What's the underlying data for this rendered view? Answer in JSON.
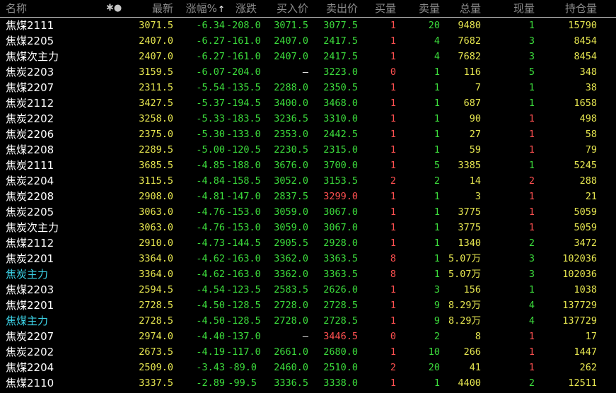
{
  "columns": {
    "name": "名称",
    "last": "最新",
    "pct": "涨幅%",
    "chg": "涨跌",
    "bid": "买入价",
    "ask": "卖出价",
    "bid_vol": "买量",
    "ask_vol": "卖量",
    "volume": "总量",
    "cur_vol": "现量",
    "open_interest": "持仓量"
  },
  "header_icons": {
    "star": "✱",
    "dot": "●",
    "sort_arrow": "↑"
  },
  "colors": {
    "background": "#000000",
    "up": "#ff5050",
    "down": "#3cdc3c",
    "price_yellow": "#e6e650",
    "highlight_name": "#3cd2e6",
    "header_text": "#8c8c8c"
  },
  "rows": [
    {
      "name": "焦煤2111",
      "last": "3071.5",
      "pct": "-6.34",
      "chg": "-208.0",
      "bid": "3071.5",
      "ask": "3077.5",
      "bid_vol": "1",
      "ask_vol": "20",
      "volume": "9480",
      "cur_vol": "1",
      "open_interest": "15790",
      "name_color": "normal",
      "bid_color": "green",
      "ask_color": "green",
      "cur_color": "green",
      "selected": true
    },
    {
      "name": "焦煤2205",
      "last": "2407.0",
      "pct": "-6.27",
      "chg": "-161.0",
      "bid": "2407.0",
      "ask": "2417.5",
      "bid_vol": "1",
      "ask_vol": "4",
      "volume": "7682",
      "cur_vol": "3",
      "open_interest": "8454",
      "name_color": "normal",
      "bid_color": "green",
      "ask_color": "green",
      "cur_color": "green"
    },
    {
      "name": "焦煤次主力",
      "last": "2407.0",
      "pct": "-6.27",
      "chg": "-161.0",
      "bid": "2407.0",
      "ask": "2417.5",
      "bid_vol": "1",
      "ask_vol": "4",
      "volume": "7682",
      "cur_vol": "3",
      "open_interest": "8454",
      "name_color": "normal",
      "bid_color": "green",
      "ask_color": "green",
      "cur_color": "green"
    },
    {
      "name": "焦炭2203",
      "last": "3159.5",
      "pct": "-6.07",
      "chg": "-204.0",
      "bid": "—",
      "ask": "3223.0",
      "bid_vol": "0",
      "ask_vol": "1",
      "volume": "116",
      "cur_vol": "5",
      "open_interest": "348",
      "name_color": "normal",
      "bid_color": "dash",
      "ask_color": "green",
      "cur_color": "green"
    },
    {
      "name": "焦煤2207",
      "last": "2311.5",
      "pct": "-5.54",
      "chg": "-135.5",
      "bid": "2288.0",
      "ask": "2350.5",
      "bid_vol": "1",
      "ask_vol": "1",
      "volume": "7",
      "cur_vol": "1",
      "open_interest": "38",
      "name_color": "normal",
      "bid_color": "green",
      "ask_color": "green",
      "cur_color": "green"
    },
    {
      "name": "焦炭2112",
      "last": "3427.5",
      "pct": "-5.37",
      "chg": "-194.5",
      "bid": "3400.0",
      "ask": "3468.0",
      "bid_vol": "1",
      "ask_vol": "1",
      "volume": "687",
      "cur_vol": "1",
      "open_interest": "1658",
      "name_color": "normal",
      "bid_color": "green",
      "ask_color": "green",
      "cur_color": "green"
    },
    {
      "name": "焦炭2202",
      "last": "3258.0",
      "pct": "-5.33",
      "chg": "-183.5",
      "bid": "3236.5",
      "ask": "3310.0",
      "bid_vol": "1",
      "ask_vol": "1",
      "volume": "90",
      "cur_vol": "1",
      "open_interest": "498",
      "name_color": "normal",
      "bid_color": "green",
      "ask_color": "green",
      "cur_color": "red"
    },
    {
      "name": "焦炭2206",
      "last": "2375.0",
      "pct": "-5.30",
      "chg": "-133.0",
      "bid": "2353.0",
      "ask": "2442.5",
      "bid_vol": "1",
      "ask_vol": "1",
      "volume": "27",
      "cur_vol": "1",
      "open_interest": "58",
      "name_color": "normal",
      "bid_color": "green",
      "ask_color": "green",
      "cur_color": "red"
    },
    {
      "name": "焦煤2208",
      "last": "2289.5",
      "pct": "-5.00",
      "chg": "-120.5",
      "bid": "2230.5",
      "ask": "2315.0",
      "bid_vol": "1",
      "ask_vol": "1",
      "volume": "59",
      "cur_vol": "1",
      "open_interest": "79",
      "name_color": "normal",
      "bid_color": "green",
      "ask_color": "green",
      "cur_color": "red"
    },
    {
      "name": "焦炭2111",
      "last": "3685.5",
      "pct": "-4.85",
      "chg": "-188.0",
      "bid": "3676.0",
      "ask": "3700.0",
      "bid_vol": "1",
      "ask_vol": "5",
      "volume": "3385",
      "cur_vol": "1",
      "open_interest": "5245",
      "name_color": "normal",
      "bid_color": "green",
      "ask_color": "green",
      "cur_color": "green"
    },
    {
      "name": "焦炭2204",
      "last": "3115.5",
      "pct": "-4.84",
      "chg": "-158.5",
      "bid": "3052.0",
      "ask": "3153.5",
      "bid_vol": "2",
      "ask_vol": "2",
      "volume": "14",
      "cur_vol": "2",
      "open_interest": "288",
      "name_color": "normal",
      "bid_color": "green",
      "ask_color": "green",
      "cur_color": "red"
    },
    {
      "name": "焦炭2208",
      "last": "2908.0",
      "pct": "-4.81",
      "chg": "-147.0",
      "bid": "2837.5",
      "ask": "3299.0",
      "bid_vol": "1",
      "ask_vol": "1",
      "volume": "3",
      "cur_vol": "1",
      "open_interest": "21",
      "name_color": "normal",
      "bid_color": "green",
      "ask_color": "red",
      "cur_color": "red"
    },
    {
      "name": "焦炭2205",
      "last": "3063.0",
      "pct": "-4.76",
      "chg": "-153.0",
      "bid": "3059.0",
      "ask": "3067.0",
      "bid_vol": "1",
      "ask_vol": "1",
      "volume": "3775",
      "cur_vol": "1",
      "open_interest": "5059",
      "name_color": "normal",
      "bid_color": "green",
      "ask_color": "green",
      "cur_color": "red"
    },
    {
      "name": "焦炭次主力",
      "last": "3063.0",
      "pct": "-4.76",
      "chg": "-153.0",
      "bid": "3059.0",
      "ask": "3067.0",
      "bid_vol": "1",
      "ask_vol": "1",
      "volume": "3775",
      "cur_vol": "1",
      "open_interest": "5059",
      "name_color": "normal",
      "bid_color": "green",
      "ask_color": "green",
      "cur_color": "red"
    },
    {
      "name": "焦煤2112",
      "last": "2910.0",
      "pct": "-4.73",
      "chg": "-144.5",
      "bid": "2905.5",
      "ask": "2928.0",
      "bid_vol": "1",
      "ask_vol": "1",
      "volume": "1340",
      "cur_vol": "2",
      "open_interest": "3472",
      "name_color": "normal",
      "bid_color": "green",
      "ask_color": "green",
      "cur_color": "green"
    },
    {
      "name": "焦炭2201",
      "last": "3364.0",
      "pct": "-4.62",
      "chg": "-163.0",
      "bid": "3362.0",
      "ask": "3363.5",
      "bid_vol": "8",
      "ask_vol": "1",
      "volume": "5.07万",
      "cur_vol": "3",
      "open_interest": "102036",
      "name_color": "normal",
      "bid_color": "green",
      "ask_color": "green",
      "cur_color": "green"
    },
    {
      "name": "焦炭主力",
      "last": "3364.0",
      "pct": "-4.62",
      "chg": "-163.0",
      "bid": "3362.0",
      "ask": "3363.5",
      "bid_vol": "8",
      "ask_vol": "1",
      "volume": "5.07万",
      "cur_vol": "3",
      "open_interest": "102036",
      "name_color": "cyan",
      "bid_color": "green",
      "ask_color": "green",
      "cur_color": "green"
    },
    {
      "name": "焦煤2203",
      "last": "2594.5",
      "pct": "-4.54",
      "chg": "-123.5",
      "bid": "2583.5",
      "ask": "2626.0",
      "bid_vol": "1",
      "ask_vol": "3",
      "volume": "156",
      "cur_vol": "1",
      "open_interest": "1038",
      "name_color": "normal",
      "bid_color": "green",
      "ask_color": "green",
      "cur_color": "green"
    },
    {
      "name": "焦煤2201",
      "last": "2728.5",
      "pct": "-4.50",
      "chg": "-128.5",
      "bid": "2728.0",
      "ask": "2728.5",
      "bid_vol": "1",
      "ask_vol": "9",
      "volume": "8.29万",
      "cur_vol": "4",
      "open_interest": "137729",
      "name_color": "normal",
      "bid_color": "green",
      "ask_color": "green",
      "cur_color": "green"
    },
    {
      "name": "焦煤主力",
      "last": "2728.5",
      "pct": "-4.50",
      "chg": "-128.5",
      "bid": "2728.0",
      "ask": "2728.5",
      "bid_vol": "1",
      "ask_vol": "9",
      "volume": "8.29万",
      "cur_vol": "4",
      "open_interest": "137729",
      "name_color": "cyan",
      "bid_color": "green",
      "ask_color": "green",
      "cur_color": "green"
    },
    {
      "name": "焦炭2207",
      "last": "2974.0",
      "pct": "-4.40",
      "chg": "-137.0",
      "bid": "—",
      "ask": "3446.5",
      "bid_vol": "0",
      "ask_vol": "2",
      "volume": "8",
      "cur_vol": "1",
      "open_interest": "17",
      "name_color": "normal",
      "bid_color": "dash",
      "ask_color": "red",
      "cur_color": "red"
    },
    {
      "name": "焦炭2202",
      "last": "2673.5",
      "pct": "-4.19",
      "chg": "-117.0",
      "bid": "2661.0",
      "ask": "2680.0",
      "bid_vol": "1",
      "ask_vol": "10",
      "volume": "266",
      "cur_vol": "1",
      "open_interest": "1447",
      "name_color": "normal",
      "bid_color": "green",
      "ask_color": "green",
      "cur_color": "red"
    },
    {
      "name": "焦煤2204",
      "last": "2509.0",
      "pct": "-3.43",
      "chg": "-89.0",
      "bid": "2460.0",
      "ask": "2510.0",
      "bid_vol": "2",
      "ask_vol": "20",
      "volume": "41",
      "cur_vol": "1",
      "open_interest": "262",
      "name_color": "normal",
      "bid_color": "green",
      "ask_color": "green",
      "cur_color": "red"
    },
    {
      "name": "焦煤2110",
      "last": "3337.5",
      "pct": "-2.89",
      "chg": "-99.5",
      "bid": "3336.5",
      "ask": "3338.0",
      "bid_vol": "1",
      "ask_vol": "1",
      "volume": "4400",
      "cur_vol": "2",
      "open_interest": "12511",
      "name_color": "normal",
      "bid_color": "green",
      "ask_color": "green",
      "cur_color": "green"
    }
  ]
}
